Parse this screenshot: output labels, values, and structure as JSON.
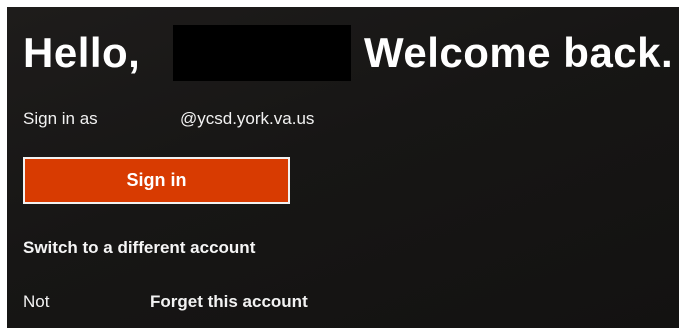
{
  "greeting": {
    "hello": "Hello,",
    "welcome": "Welcome back."
  },
  "account": {
    "sign_in_as_label": "Sign in as",
    "email_domain": "@ycsd.york.va.us"
  },
  "actions": {
    "sign_in_label": "Sign in",
    "switch_account_label": "Switch to a different account",
    "not_label": "Not",
    "forget_account_label": "Forget this account"
  },
  "colors": {
    "background": "#171615",
    "accent": "#d83b01",
    "text": "#ffffff"
  }
}
